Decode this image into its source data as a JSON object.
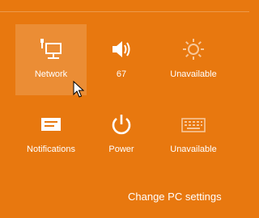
{
  "colors": {
    "background": "#e8780f",
    "foreground": "#ffffff",
    "selected_tile": "rgba(255,255,255,0.16)"
  },
  "quick_settings": [
    {
      "label": "Network",
      "icon": "network-icon",
      "state": "selected"
    },
    {
      "label": "67",
      "icon": "speaker-icon"
    },
    {
      "label": "Unavailable",
      "icon": "brightness-icon",
      "state": "disabled"
    },
    {
      "label": "Notifications",
      "icon": "notifications-icon"
    },
    {
      "label": "Power",
      "icon": "power-icon"
    },
    {
      "label": "Unavailable",
      "icon": "keyboard-icon",
      "state": "disabled"
    }
  ],
  "footer": {
    "change_pc_settings": "Change PC settings"
  }
}
